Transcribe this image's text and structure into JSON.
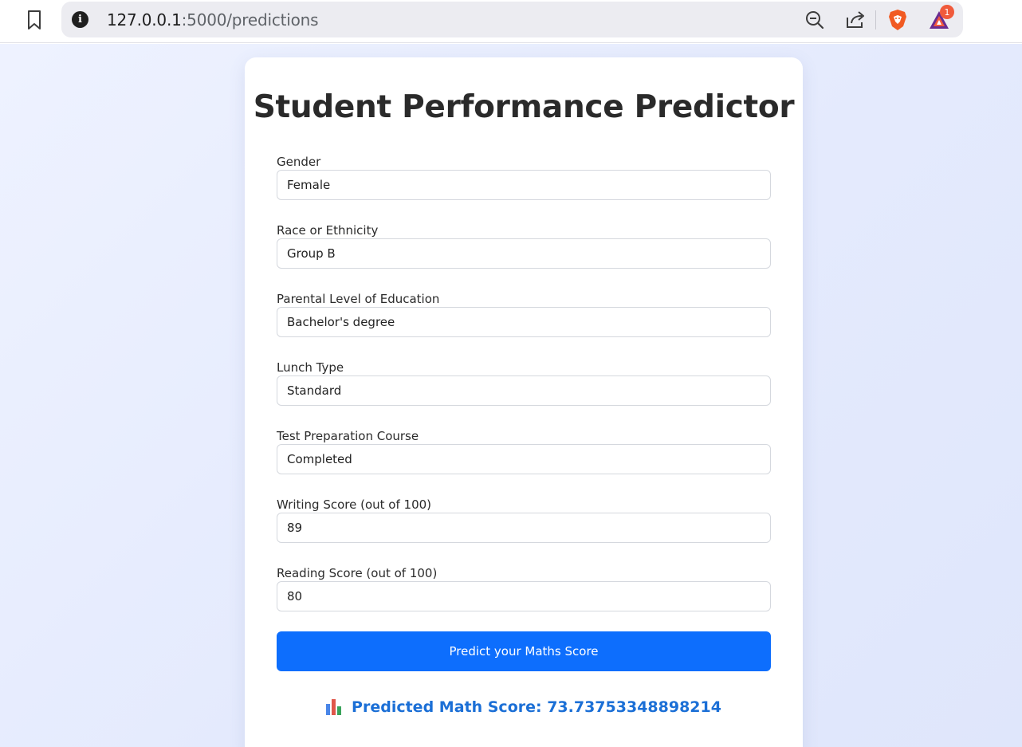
{
  "browser": {
    "url_host": "127.0.0.1",
    "url_path": ":5000/predictions",
    "extension_badge": "1"
  },
  "page": {
    "title": "Student Performance Predictor",
    "fields": [
      {
        "label": "Gender",
        "value": "Female"
      },
      {
        "label": "Race or Ethnicity",
        "value": "Group B"
      },
      {
        "label": "Parental Level of Education",
        "value": "Bachelor's degree"
      },
      {
        "label": "Lunch Type",
        "value": "Standard"
      },
      {
        "label": "Test Preparation Course",
        "value": "Completed"
      },
      {
        "label": "Writing Score (out of 100)",
        "value": "89"
      },
      {
        "label": "Reading Score (out of 100)",
        "value": "80"
      }
    ],
    "submit_label": "Predict your Maths Score",
    "result_text": "Predicted Math Score: 73.73753348898214",
    "result_icon": "bar-chart-icon"
  },
  "colors": {
    "accent": "#0d6efd",
    "result": "#1b6fd6"
  }
}
